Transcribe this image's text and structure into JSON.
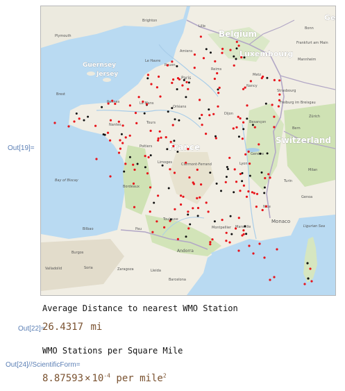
{
  "cells": [
    {
      "label": "Out[19]="
    },
    {
      "label": "Out[22]=",
      "value": "26.4317",
      "unit": "mi"
    },
    {
      "label": "Out[24]//ScientificForm=",
      "mantissa": "8.87593",
      "times": "×",
      "base": "10",
      "exponent": "-4",
      "unit_text": "per mile",
      "unit_exp": "2"
    }
  ],
  "headings": {
    "avg_distance": "Average Distance to nearest WMO Station",
    "per_sq_mile": "WMO Stations per Square Mile"
  },
  "map": {
    "labels": {
      "belgium": "Belgium",
      "luxembourg": "Luxembourg",
      "france": "France",
      "switzerland": "Switzerland",
      "guernsey": "Guernsey",
      "jersey": "Jersey",
      "monaco": "Monaco",
      "andorra": "Andorra",
      "ger": "Ger",
      "brighton": "Brighton",
      "plymouth": "Plymouth",
      "lille": "Lille",
      "amiens": "Amiens",
      "le_havre": "Le Havre",
      "rouen": "Rouen",
      "paris": "Paris",
      "reims": "Reims",
      "metz": "Metz",
      "nancy": "Nancy",
      "strasbourg": "Strasbourg",
      "brest": "Brest",
      "rennes": "Rennes",
      "le_mans": "Le Mans",
      "orleans": "Orléans",
      "nantes": "Nantes",
      "tours": "Tours",
      "dijon": "Dijon",
      "besancon": "Besançon",
      "freiburg": "Freiburg im Breisgau",
      "zurich": "Zürich",
      "bern": "Bern",
      "geneva": "Genève",
      "lyon": "Lyon",
      "clermont": "Clermont-Ferrand",
      "limoges": "Limoges",
      "poitiers": "Poitiers",
      "bordeaux": "Bordeaux",
      "toulouse": "Toulouse",
      "montpellier": "Montpellier",
      "marseille": "Marseille",
      "nice": "Nice",
      "milan": "Milan",
      "turin": "Turin",
      "genoa": "Genoa",
      "bay_of_biscay": "Bay of Biscay",
      "ligurian_sea": "Ligurian Sea",
      "bilbao": "Bilbao",
      "pau": "Pau",
      "burgos": "Burgos",
      "zaragoza": "Zaragoza",
      "lleida": "Lleida",
      "barcelona": "Barcelona",
      "valladolid": "Valladolid",
      "soria": "Soria",
      "frankfurt": "Frankfurt am Main",
      "mannheim": "Mannheim",
      "bonn": "Bonn"
    },
    "colors": {
      "sea": "#b9daf2",
      "land": "#f1eee4",
      "green": "#c9dfb0",
      "red_station": "#e8141b",
      "black_station": "#111111",
      "border": "#b2a7c6"
    }
  }
}
